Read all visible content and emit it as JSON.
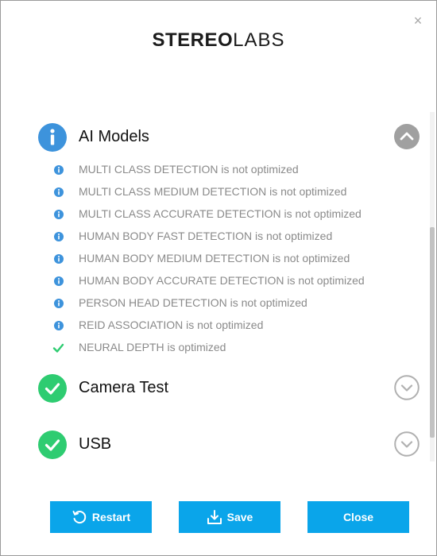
{
  "window": {
    "close_glyph": "×"
  },
  "logo": {
    "bold": "STEREO",
    "light": "LABS"
  },
  "sections": [
    {
      "title": "AI Models",
      "status": "info",
      "expanded": true
    },
    {
      "title": "Camera Test",
      "status": "ok",
      "expanded": false
    },
    {
      "title": "USB",
      "status": "ok",
      "expanded": false
    }
  ],
  "ai_models": [
    {
      "text": "MULTI CLASS DETECTION is not optimized",
      "status": "info"
    },
    {
      "text": "MULTI CLASS MEDIUM DETECTION is not optimized",
      "status": "info"
    },
    {
      "text": "MULTI CLASS ACCURATE DETECTION is not optimized",
      "status": "info"
    },
    {
      "text": "HUMAN BODY FAST DETECTION is not optimized",
      "status": "info"
    },
    {
      "text": "HUMAN BODY MEDIUM DETECTION is not optimized",
      "status": "info"
    },
    {
      "text": "HUMAN BODY ACCURATE DETECTION is not optimized",
      "status": "info"
    },
    {
      "text": "PERSON HEAD DETECTION is not optimized",
      "status": "info"
    },
    {
      "text": "REID ASSOCIATION is not optimized",
      "status": "info"
    },
    {
      "text": "NEURAL DEPTH is optimized",
      "status": "ok"
    }
  ],
  "buttons": {
    "restart": "Restart",
    "save": "Save",
    "close": "Close"
  },
  "colors": {
    "info_blue": "#3d93dc",
    "ok_green": "#2ecc71",
    "button_blue": "#0aa5ea",
    "collapse_gray": "#a0a0a0"
  }
}
